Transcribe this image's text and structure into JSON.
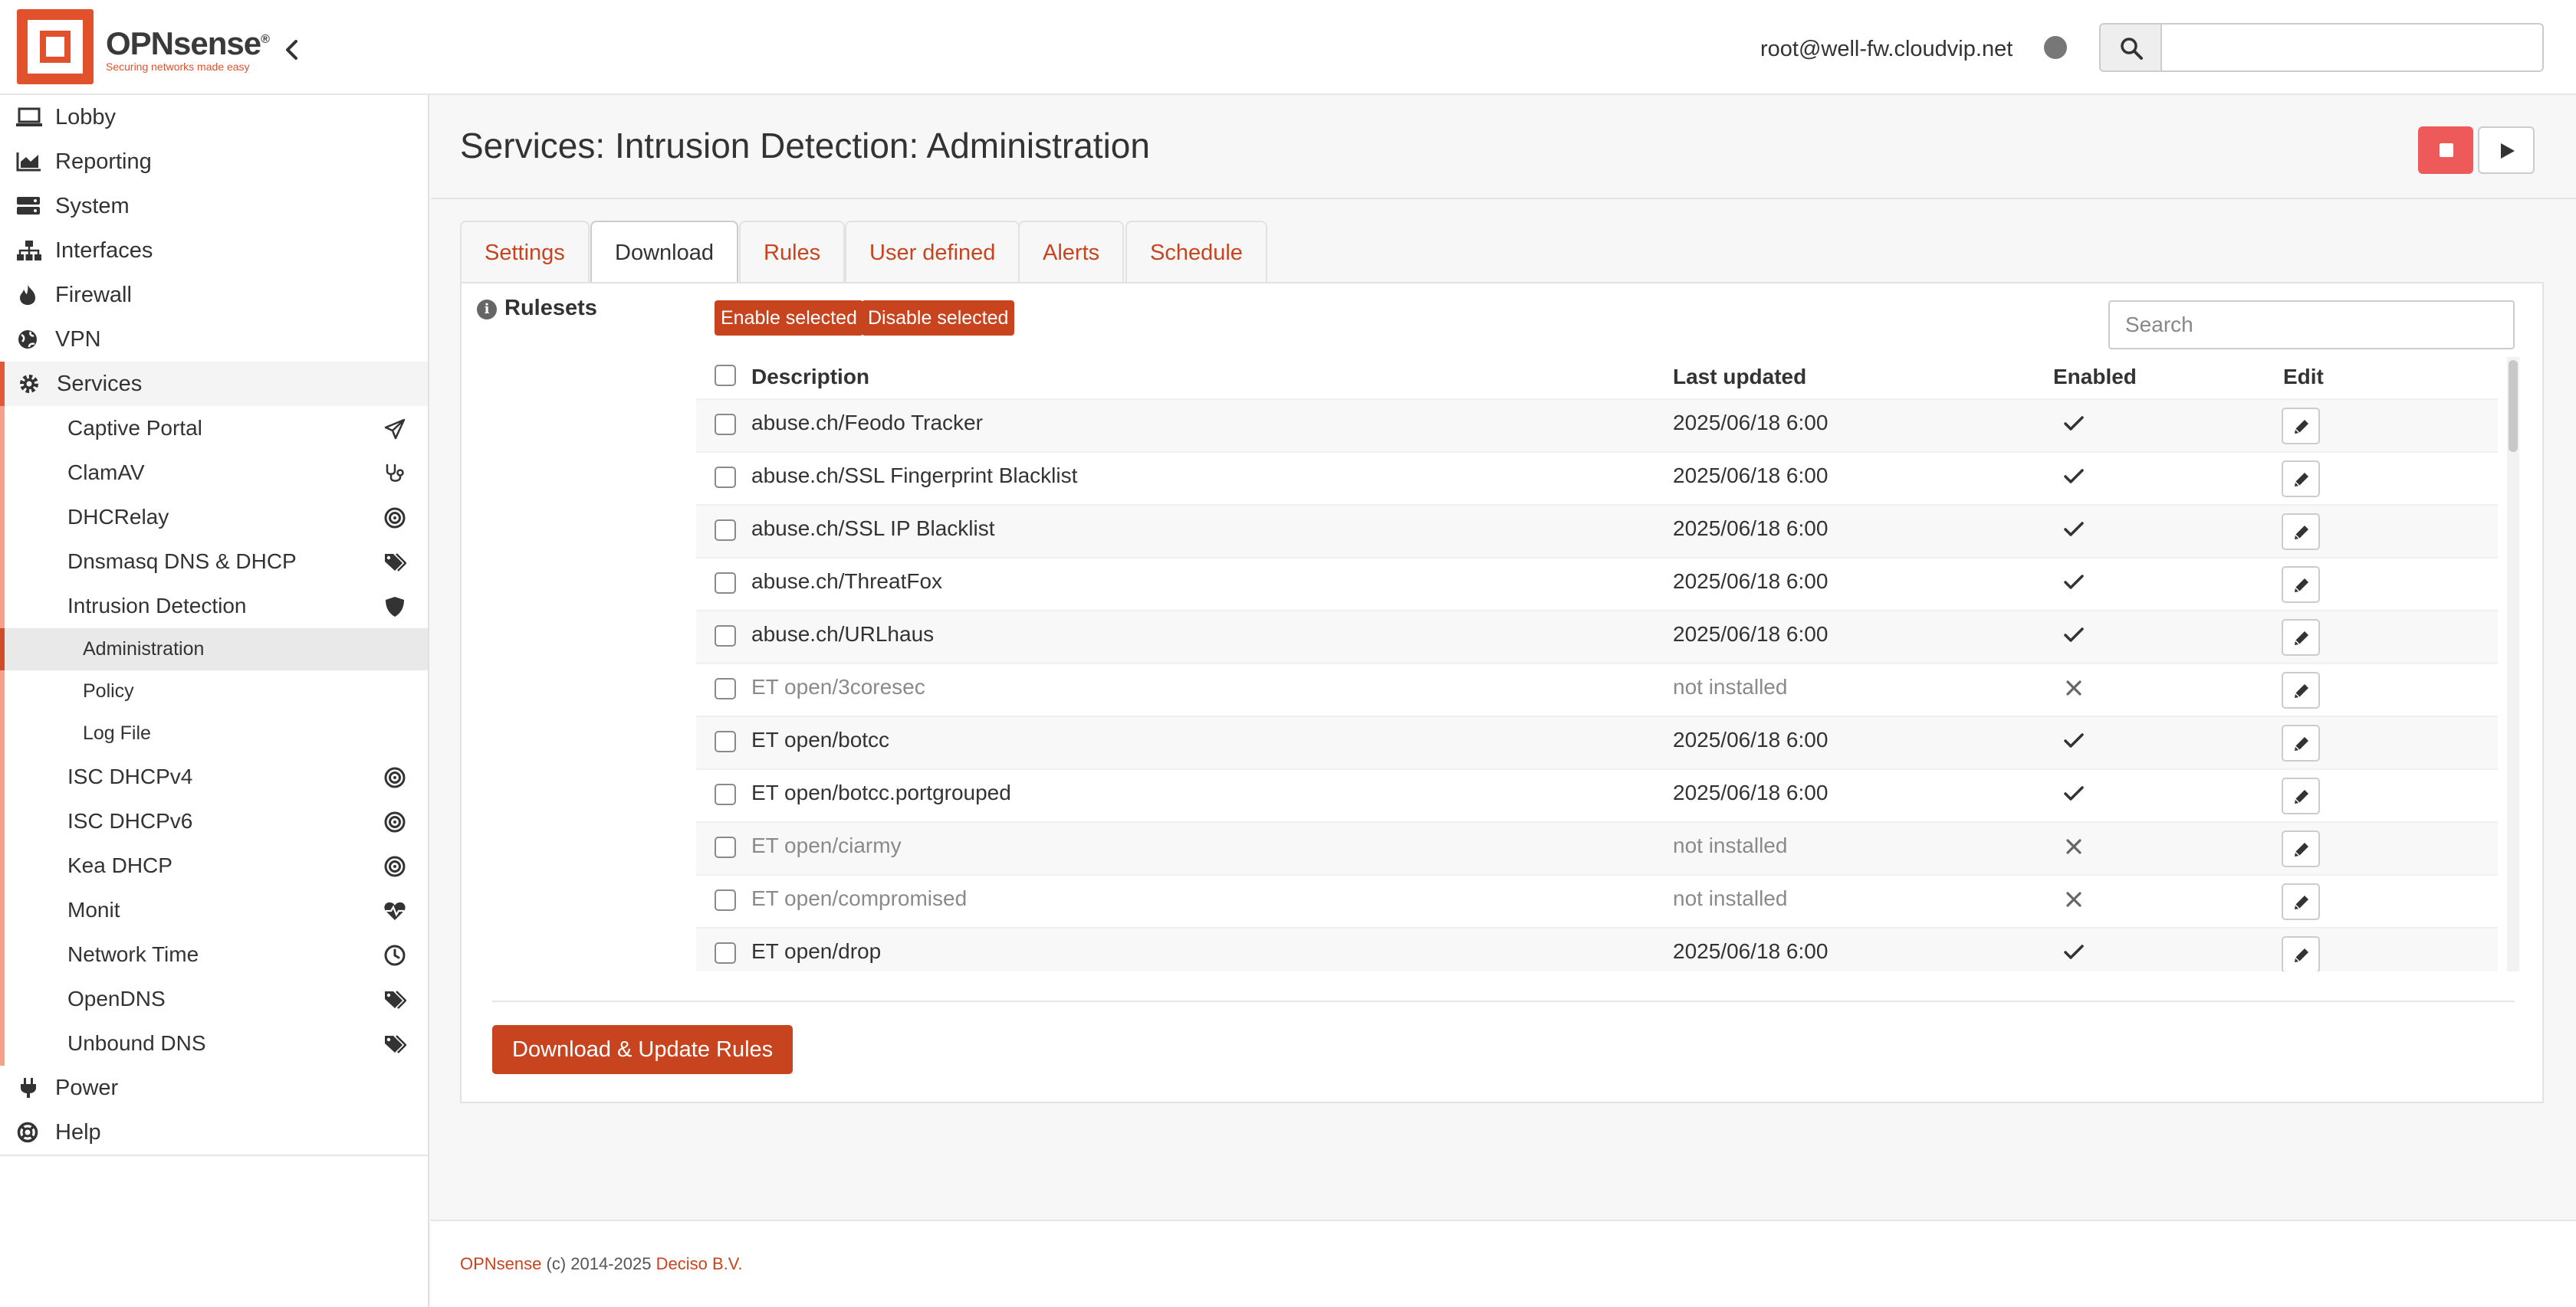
{
  "brand": {
    "name": "OPNsense",
    "trademark": "®",
    "tagline": "Securing networks made easy",
    "accent_color": "#e0512c",
    "logo_icon": "opnsense-logo-icon"
  },
  "header": {
    "user": "root@well-fw.cloudvip.net",
    "status_indicator": "status-dot",
    "search_placeholder": ""
  },
  "sidebar": {
    "top_items": [
      {
        "label": "Lobby",
        "icon": "laptop-icon"
      },
      {
        "label": "Reporting",
        "icon": "area-chart-icon"
      },
      {
        "label": "System",
        "icon": "server-icon"
      },
      {
        "label": "Interfaces",
        "icon": "sitemap-icon"
      },
      {
        "label": "Firewall",
        "icon": "fire-icon"
      },
      {
        "label": "VPN",
        "icon": "globe-icon"
      }
    ],
    "active_item": {
      "label": "Services",
      "icon": "cog-icon"
    },
    "services_submenu": [
      {
        "label": "Captive Portal",
        "icon": "paper-plane-icon"
      },
      {
        "label": "ClamAV",
        "icon": "stethoscope-icon"
      },
      {
        "label": "DHCRelay",
        "icon": "bullseye-icon"
      },
      {
        "label": "Dnsmasq DNS & DHCP",
        "icon": "tags-icon"
      },
      {
        "label": "Intrusion Detection",
        "icon": "shield-icon"
      }
    ],
    "ids_children": [
      {
        "label": "Administration",
        "selected": true
      },
      {
        "label": "Policy"
      },
      {
        "label": "Log File"
      }
    ],
    "services_submenu_rest": [
      {
        "label": "ISC DHCPv4",
        "icon": "bullseye-icon"
      },
      {
        "label": "ISC DHCPv6",
        "icon": "bullseye-icon"
      },
      {
        "label": "Kea DHCP",
        "icon": "bullseye-icon"
      },
      {
        "label": "Monit",
        "icon": "heartbeat-icon"
      },
      {
        "label": "Network Time",
        "icon": "clock-icon"
      },
      {
        "label": "OpenDNS",
        "icon": "tags-icon"
      },
      {
        "label": "Unbound DNS",
        "icon": "tags-icon"
      }
    ],
    "bottom_items": [
      {
        "label": "Power",
        "icon": "plug-icon"
      },
      {
        "label": "Help",
        "icon": "life-ring-icon"
      }
    ]
  },
  "page": {
    "title": "Services: Intrusion Detection: Administration",
    "service_controls": {
      "stop": "stop-icon",
      "start": "play-icon",
      "stop_color": "#ee5a5a"
    }
  },
  "tabs": [
    {
      "label": "Settings"
    },
    {
      "label": "Download",
      "active": true
    },
    {
      "label": "Rules"
    },
    {
      "label": "User defined"
    },
    {
      "label": "Alerts"
    },
    {
      "label": "Schedule"
    }
  ],
  "rulesets": {
    "heading": "Rulesets",
    "enable_selected": "Enable selected",
    "disable_selected": "Disable selected",
    "search_placeholder": "Search",
    "columns": {
      "description": "Description",
      "last_updated": "Last updated",
      "enabled": "Enabled",
      "edit": "Edit"
    },
    "rows": [
      {
        "description": "abuse.ch/Feodo Tracker",
        "last_updated": "2025/06/18 6:00",
        "enabled": true
      },
      {
        "description": "abuse.ch/SSL Fingerprint Blacklist",
        "last_updated": "2025/06/18 6:00",
        "enabled": true
      },
      {
        "description": "abuse.ch/SSL IP Blacklist",
        "last_updated": "2025/06/18 6:00",
        "enabled": true
      },
      {
        "description": "abuse.ch/ThreatFox",
        "last_updated": "2025/06/18 6:00",
        "enabled": true
      },
      {
        "description": "abuse.ch/URLhaus",
        "last_updated": "2025/06/18 6:00",
        "enabled": true
      },
      {
        "description": "ET open/3coresec",
        "last_updated": "not installed",
        "enabled": false
      },
      {
        "description": "ET open/botcc",
        "last_updated": "2025/06/18 6:00",
        "enabled": true
      },
      {
        "description": "ET open/botcc.portgrouped",
        "last_updated": "2025/06/18 6:00",
        "enabled": true
      },
      {
        "description": "ET open/ciarmy",
        "last_updated": "not installed",
        "enabled": false
      },
      {
        "description": "ET open/compromised",
        "last_updated": "not installed",
        "enabled": false
      },
      {
        "description": "ET open/drop",
        "last_updated": "2025/06/18 6:00",
        "enabled": true
      }
    ],
    "download_button": "Download & Update Rules"
  },
  "footer": {
    "brand_link": "OPNsense",
    "copyright": " (c) 2014-2025 ",
    "company_link": "Deciso B.V."
  }
}
